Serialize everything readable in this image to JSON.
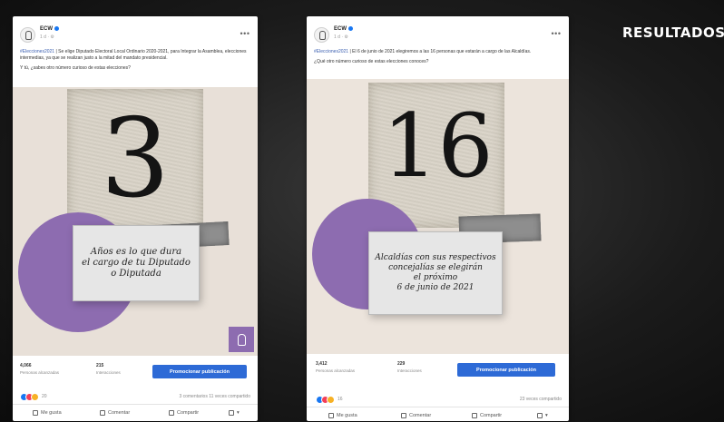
{
  "slide": {
    "title": "RESULTADOS"
  },
  "colors": {
    "accent_purple": "#8d6cb0",
    "promote_blue": "#2d6ad6",
    "link_blue": "#3b5fb0"
  },
  "posts": [
    {
      "page_name": "ECW",
      "time": "1 d · ⚙",
      "caption_hashtag": "#Elecciones2021",
      "caption_line1": "| Se elige Diputado Electoral Local Ordinario 2020-2021, para Integrar la Asamblea, elecciones intermedias, ya que se realizan justo a la mitad del mandato presidencial.",
      "caption_line2": "Y tú, ¿sabes otro número curioso de estas elecciones?",
      "big_number": "3",
      "card_text": "Años es lo que dura\nel cargo de tu Diputado\no Diputada",
      "stat1_value": "4,066",
      "stat1_label": "Personas alcanzadas",
      "stat2_value": "215",
      "stat2_label": "Interacciones",
      "promote_label": "Promocionar publicación",
      "reaction_count": "20",
      "engagement": "3 comentarios  11 veces compartido",
      "like_label": "Me gusta",
      "comment_label": "Comentar",
      "share_label": "Compartir"
    },
    {
      "page_name": "ECW",
      "time": "1 d · ⚙",
      "caption_hashtag": "#Elecciones2021",
      "caption_line1": "| El 6 de junio de 2021 elegiremos a las 16 personas que estarán a cargo de las Alcaldías.",
      "caption_line2": "¿Qué otro número curioso de estas elecciones conoces?",
      "big_number": "16",
      "card_text": "Alcaldías con sus respectivos\nconcejalías se elegirán\nel próximo\n6 de junio de 2021",
      "stat1_value": "3,412",
      "stat1_label": "Personas alcanzadas",
      "stat2_value": "229",
      "stat2_label": "Interacciones",
      "promote_label": "Promocionar publicación",
      "reaction_count": "16",
      "engagement": "23 veces compartido",
      "like_label": "Me gusta",
      "comment_label": "Comentar",
      "share_label": "Compartir"
    }
  ]
}
